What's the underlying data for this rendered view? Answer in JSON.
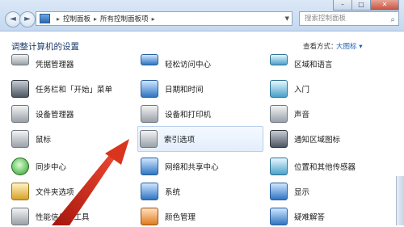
{
  "window": {
    "controls": {
      "minimize": "–",
      "maximize": "□",
      "close": "✕"
    }
  },
  "navbar": {
    "back_icon": "back-arrow-icon",
    "forward_icon": "forward-arrow-icon",
    "breadcrumb": [
      "控制面板",
      "所有控制面板项"
    ],
    "search_placeholder": "搜索控制面板"
  },
  "header": {
    "title": "调整计算机的设置",
    "view_by_label": "查看方式：",
    "view_mode": "大图标 ▾"
  },
  "items": {
    "col1": [
      {
        "label": "凭据管理器",
        "icon": "credential-manager-icon"
      },
      {
        "label": "任务栏和「开始」菜单",
        "icon": "taskbar-icon"
      },
      {
        "label": "设备管理器",
        "icon": "device-manager-icon"
      },
      {
        "label": "鼠标",
        "icon": "mouse-icon"
      },
      {
        "label": "同步中心",
        "icon": "sync-center-icon"
      },
      {
        "label": "文件夹选项",
        "icon": "folder-options-icon"
      },
      {
        "label": "性能信息和工具",
        "icon": "performance-icon"
      }
    ],
    "col2": [
      {
        "label": "轻松访问中心",
        "icon": "ease-of-access-icon"
      },
      {
        "label": "日期和时间",
        "icon": "date-time-icon"
      },
      {
        "label": "设备和打印机",
        "icon": "devices-printers-icon"
      },
      {
        "label": "索引选项",
        "icon": "indexing-options-icon"
      },
      {
        "label": "网络和共享中心",
        "icon": "network-sharing-icon"
      },
      {
        "label": "系统",
        "icon": "system-icon"
      },
      {
        "label": "颜色管理",
        "icon": "color-management-icon"
      }
    ],
    "col3": [
      {
        "label": "区域和语言",
        "icon": "region-language-icon"
      },
      {
        "label": "入门",
        "icon": "getting-started-icon"
      },
      {
        "label": "声音",
        "icon": "sound-icon"
      },
      {
        "label": "通知区域图标",
        "icon": "notification-area-icon"
      },
      {
        "label": "位置和其他传感器",
        "icon": "location-sensors-icon"
      },
      {
        "label": "显示",
        "icon": "display-icon"
      },
      {
        "label": "疑难解答",
        "icon": "troubleshooting-icon"
      }
    ]
  },
  "colors": {
    "accent": "#1f5fb4",
    "highlight": "#e3eefb",
    "arrow": "#d8341e"
  }
}
